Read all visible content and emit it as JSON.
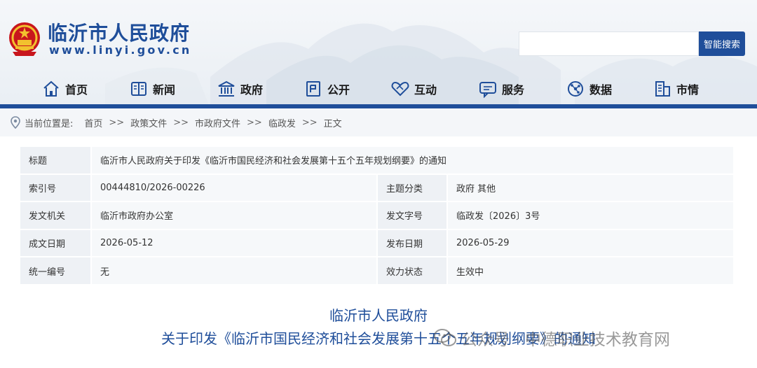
{
  "header": {
    "site_title": "临沂市人民政府",
    "site_url": "www.linyi.gov.cn"
  },
  "search": {
    "value": "",
    "placeholder": "",
    "button_label": "智能搜索"
  },
  "nav": {
    "items": [
      {
        "label": "首页",
        "icon": "home-icon"
      },
      {
        "label": "新闻",
        "icon": "newspaper-icon"
      },
      {
        "label": "政府",
        "icon": "government-building-icon"
      },
      {
        "label": "公开",
        "icon": "document-icon"
      },
      {
        "label": "互动",
        "icon": "handshake-icon"
      },
      {
        "label": "服务",
        "icon": "chat-service-icon"
      },
      {
        "label": "数据",
        "icon": "data-network-icon"
      },
      {
        "label": "市情",
        "icon": "city-building-icon"
      }
    ],
    "accent_color": "#1f4e9a"
  },
  "breadcrumb": {
    "prefix": "当前位置是:",
    "separator": ">>",
    "items": [
      "首页",
      "政策文件",
      "市政府文件",
      "临政发",
      "正文"
    ]
  },
  "meta": {
    "title_label": "标题",
    "title_value": "临沂市人民政府关于印发《临沂市国民经济和社会发展第十五个五年规划纲要》的通知",
    "rows": [
      {
        "k1": "索引号",
        "v1": "00444810/2026-00226",
        "k2": "主题分类",
        "v2": "政府 其他"
      },
      {
        "k1": "发文机关",
        "v1": "临沂市政府办公室",
        "k2": "发文字号",
        "v2": "临政发〔2026〕3号"
      },
      {
        "k1": "成文日期",
        "v1": "2026-05-12",
        "k2": "发布日期",
        "v2": "2026-05-29"
      },
      {
        "k1": "统一编号",
        "v1": "无",
        "k2": "效力状态",
        "v2": "生效中"
      }
    ]
  },
  "document": {
    "org": "临沂市人民政府",
    "title": "关于印发《临沂市国民经济和社会发展第十五个五年规划纲要》的通知"
  },
  "watermark": {
    "text": "公众号 · 中德职业技术教育网"
  }
}
